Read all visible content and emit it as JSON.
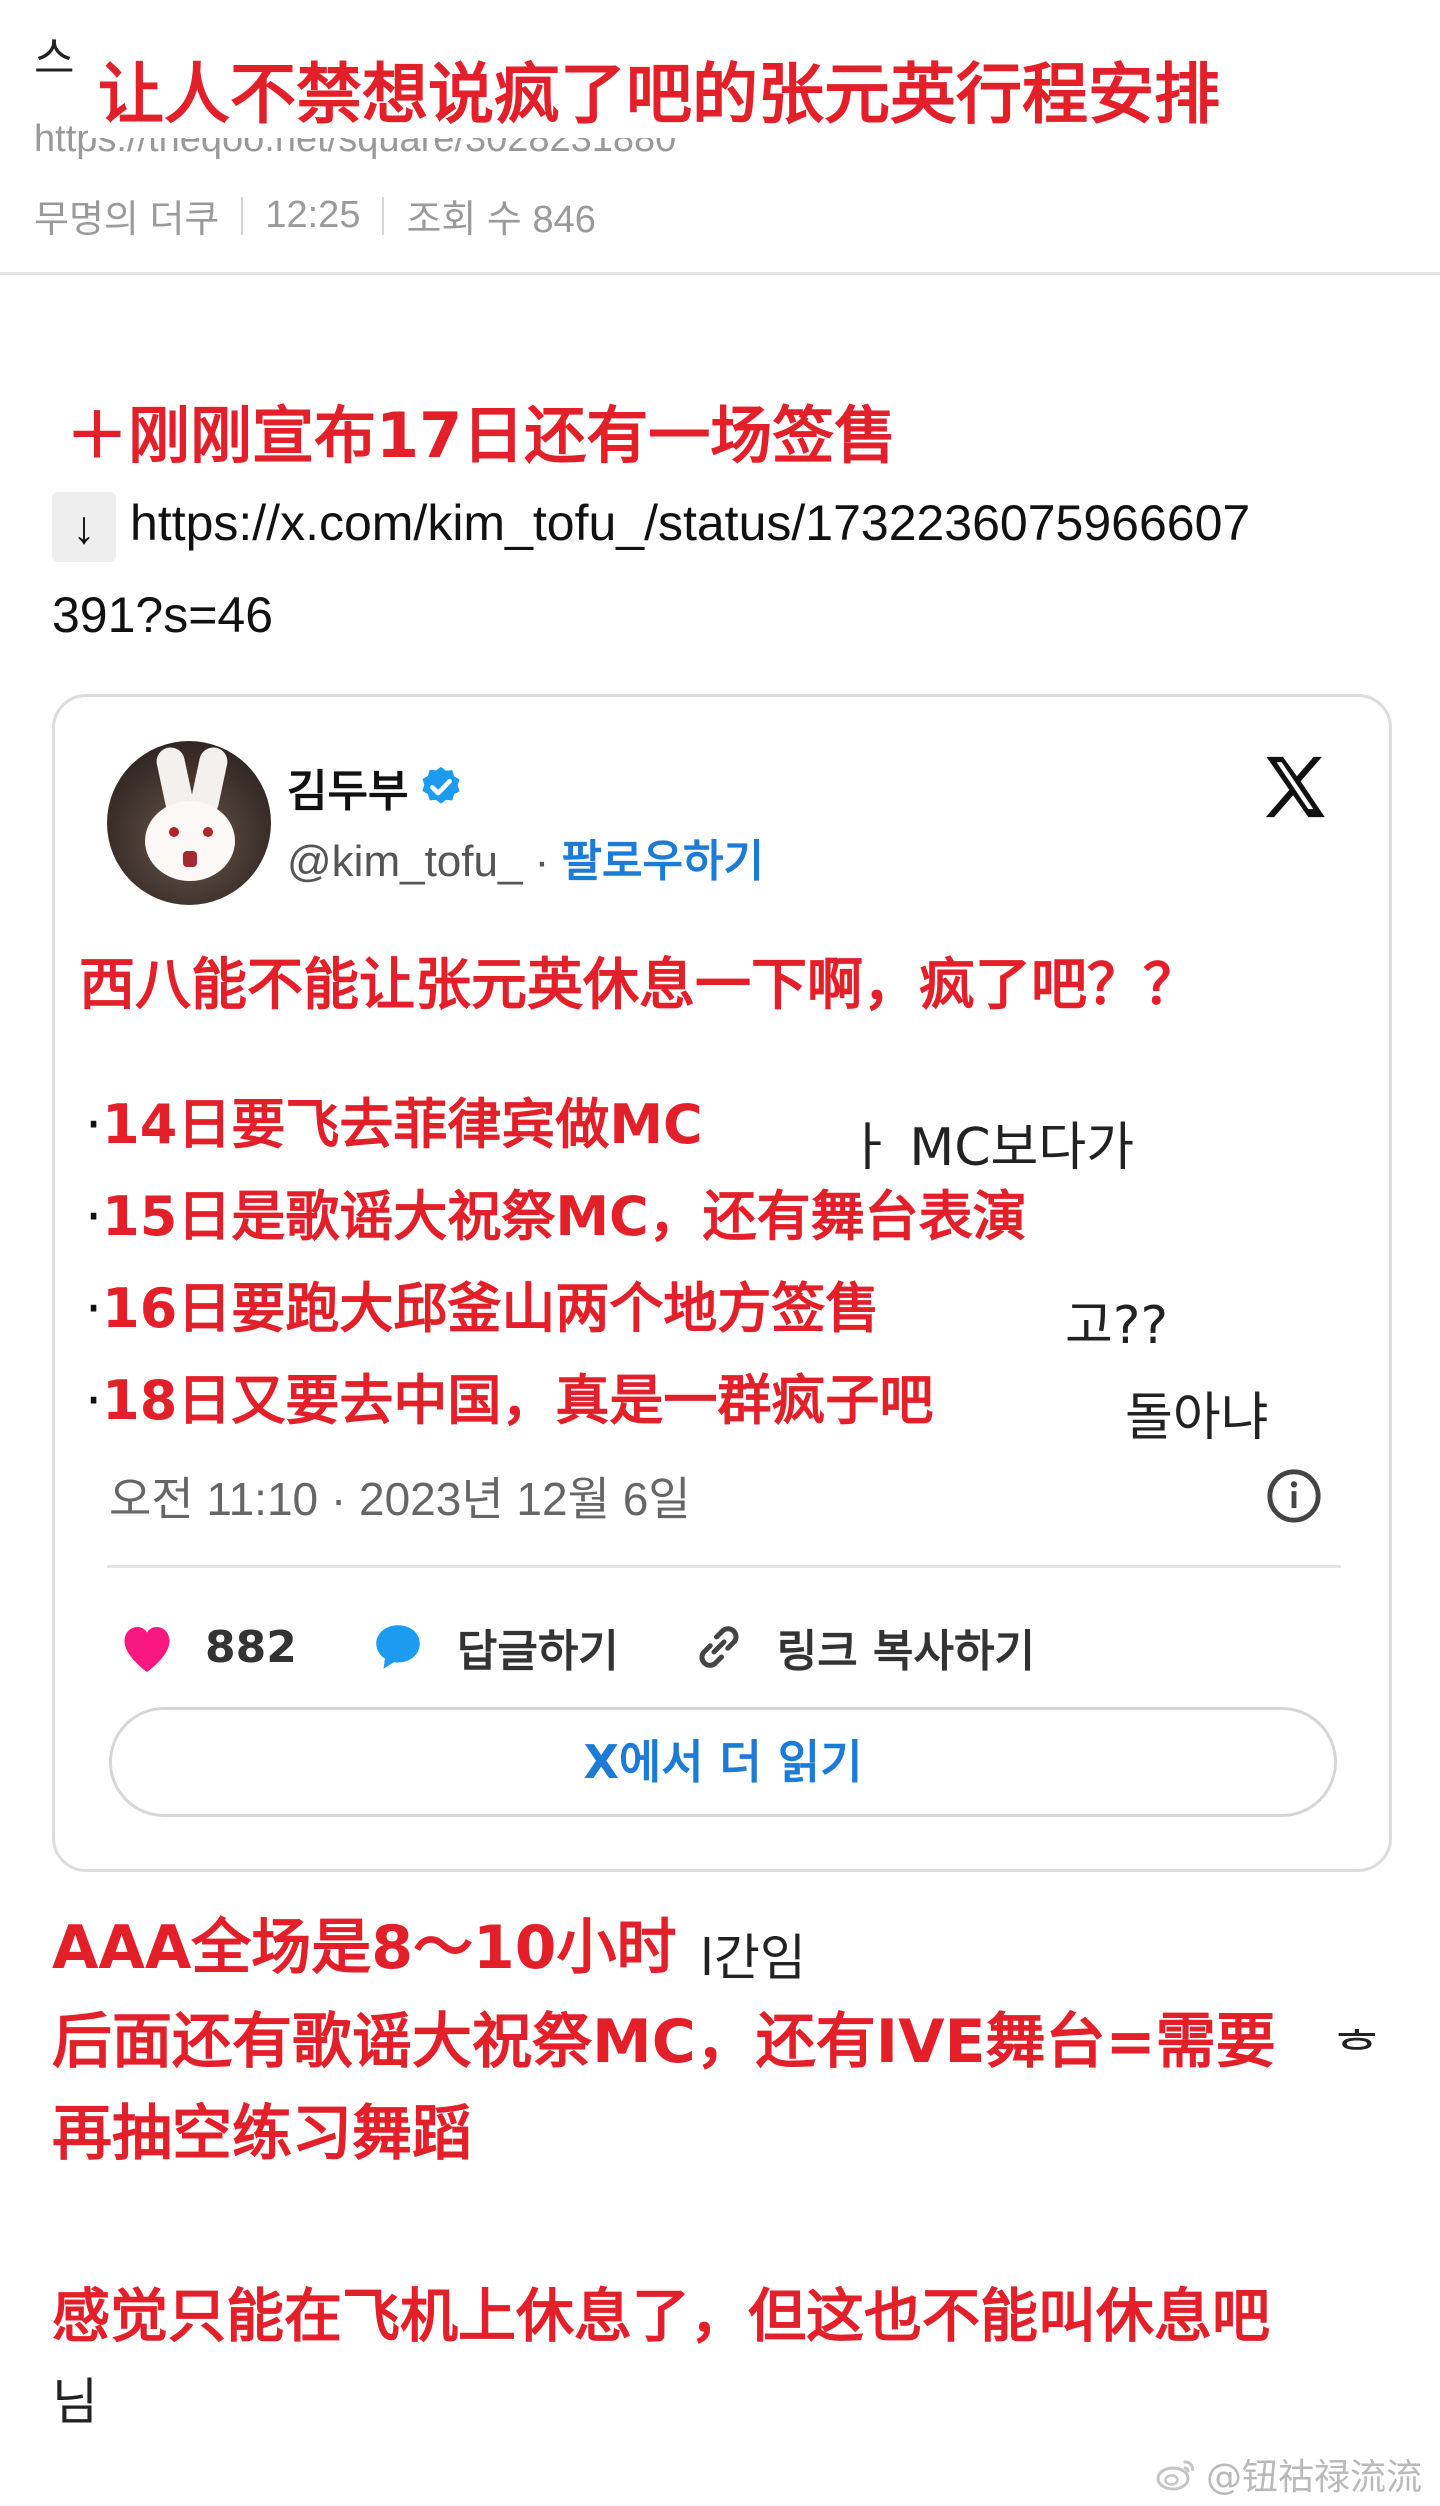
{
  "header": {
    "title_under": "스",
    "title_overlay": "让人不禁想说疯了吧的张元英行程安排",
    "url_partial": "https://theqoo.net/square/3028231880",
    "meta": {
      "author": "무명의 더쿠",
      "time": "12:25",
      "views": "조회 수 846"
    }
  },
  "update_line": "＋刚刚宣布17日还有一场签售",
  "link": {
    "arrow": "↓",
    "line1": "https://x.com/kim_tofu_/status/1732236075966607",
    "line2": "391?s=46"
  },
  "tweet": {
    "author_name": "김두부",
    "handle": "@kim_tofu_",
    "dot": " · ",
    "follow_label": "팔로우하기",
    "headline": "西八能不能让张元英休息一下啊，疯了吧？？",
    "lines": [
      {
        "bullet": "·",
        "red": "14日要飞去菲律宾做MC",
        "under": "ㅏ MC보다가"
      },
      {
        "bullet": "·",
        "red": "15日是歌谣大祝祭MC，还有舞台表演",
        "under": ""
      },
      {
        "bullet": "·",
        "red": "16日要跑大邱釜山两个地方签售",
        "under": "고??"
      },
      {
        "bullet": "·",
        "red": "18日又要去中国，真是一群疯子吧",
        "under": "돌아냐"
      }
    ],
    "timestamp": "오전 11:10 · 2023년 12월 6일",
    "likes": "882",
    "reply_label": "답글하기",
    "copy_label": "링크 복사하기",
    "read_more_label": "X에서 더 읽기"
  },
  "body": {
    "line1_red": "AAA全场是8～10小时",
    "line1_tail": "l간임",
    "line2_red": "后面还有歌谣大祝祭MC，还有IVE舞台=需要",
    "line2_tail": "ᄒ",
    "line3_red": "再抽空练习舞蹈",
    "line4_red": "感觉只能在飞机上休息了，但这也不能叫休息吧",
    "line5": "님"
  },
  "watermark": "@钮祜禄流流",
  "colors": {
    "overlay_red": "#e3202a",
    "link_blue": "#1d7bd8",
    "like_pink": "#f91880",
    "reply_blue": "#1d9bf0"
  }
}
